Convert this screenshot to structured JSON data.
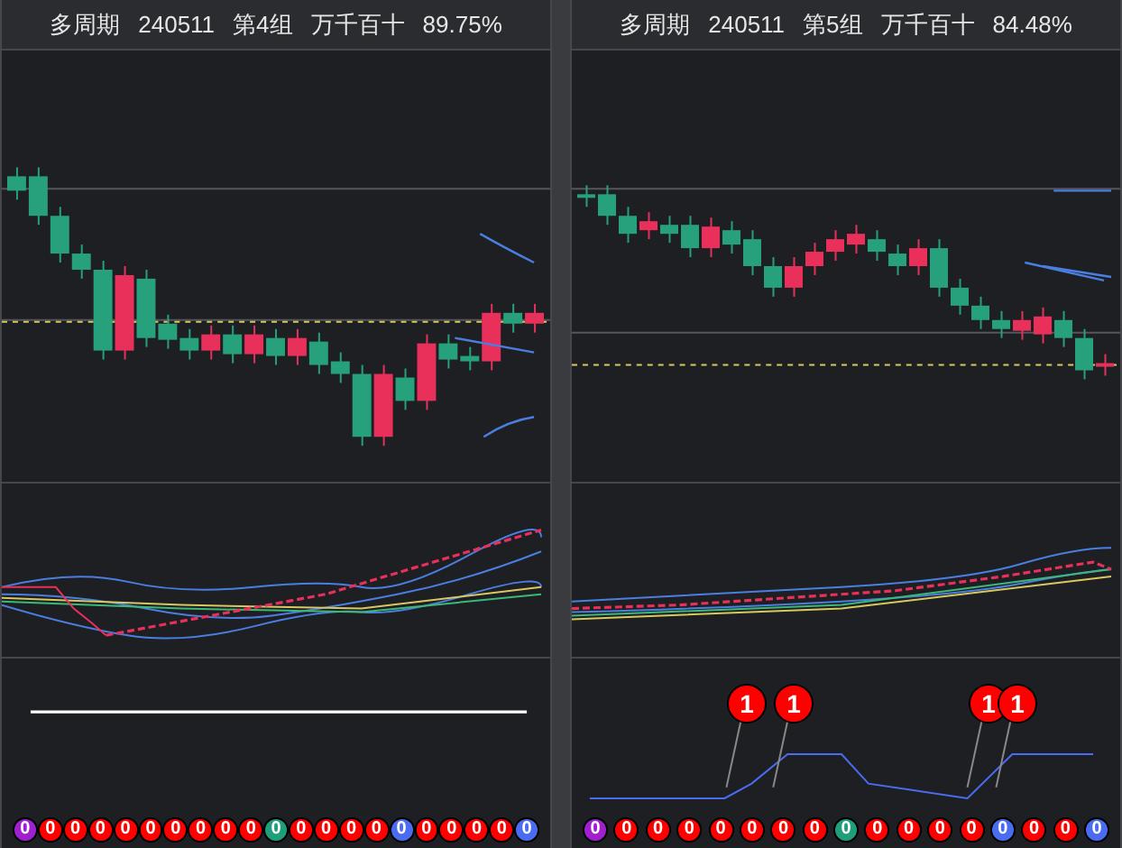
{
  "panels": [
    {
      "title_parts": [
        "多周期",
        "240511",
        "第4组",
        "万千百十",
        "89.75%"
      ],
      "balls": [
        {
          "label": "0",
          "color": "#a020d0"
        },
        {
          "label": "0",
          "color": "#ff0000"
        },
        {
          "label": "0",
          "color": "#ff0000"
        },
        {
          "label": "0",
          "color": "#ff0000"
        },
        {
          "label": "0",
          "color": "#ff0000"
        },
        {
          "label": "0",
          "color": "#ff0000"
        },
        {
          "label": "0",
          "color": "#ff0000"
        },
        {
          "label": "0",
          "color": "#ff0000"
        },
        {
          "label": "0",
          "color": "#ff0000"
        },
        {
          "label": "0",
          "color": "#ff0000"
        },
        {
          "label": "0",
          "color": "#1f9e7a"
        },
        {
          "label": "0",
          "color": "#ff0000"
        },
        {
          "label": "0",
          "color": "#ff0000"
        },
        {
          "label": "0",
          "color": "#ff0000"
        },
        {
          "label": "0",
          "color": "#ff0000"
        },
        {
          "label": "0",
          "color": "#4a6cf0"
        },
        {
          "label": "0",
          "color": "#ff0000"
        },
        {
          "label": "0",
          "color": "#ff0000"
        },
        {
          "label": "0",
          "color": "#ff0000"
        },
        {
          "label": "0",
          "color": "#ff0000"
        },
        {
          "label": "0",
          "color": "#4a6cf0"
        }
      ]
    },
    {
      "title_parts": [
        "多周期",
        "240511",
        "第5组",
        "万千百十",
        "84.48%"
      ],
      "balls": [
        {
          "label": "0",
          "color": "#a020d0"
        },
        {
          "label": "0",
          "color": "#ff0000"
        },
        {
          "label": "0",
          "color": "#ff0000"
        },
        {
          "label": "0",
          "color": "#ff0000"
        },
        {
          "label": "0",
          "color": "#ff0000"
        },
        {
          "label": "0",
          "color": "#ff0000"
        },
        {
          "label": "0",
          "color": "#ff0000"
        },
        {
          "label": "0",
          "color": "#ff0000"
        },
        {
          "label": "0",
          "color": "#1f9e7a"
        },
        {
          "label": "0",
          "color": "#ff0000"
        },
        {
          "label": "0",
          "color": "#ff0000"
        },
        {
          "label": "0",
          "color": "#ff0000"
        },
        {
          "label": "0",
          "color": "#ff0000"
        },
        {
          "label": "0",
          "color": "#4a6cf0"
        },
        {
          "label": "0",
          "color": "#ff0000"
        },
        {
          "label": "0",
          "color": "#ff0000"
        },
        {
          "label": "0",
          "color": "#4a6cf0"
        }
      ],
      "markers": [
        {
          "label": "1",
          "color": "#ff0000"
        },
        {
          "label": "1",
          "color": "#ff0000"
        },
        {
          "label": "1",
          "color": "#ff0000"
        },
        {
          "label": "1",
          "color": "#ff0000"
        }
      ]
    }
  ]
}
